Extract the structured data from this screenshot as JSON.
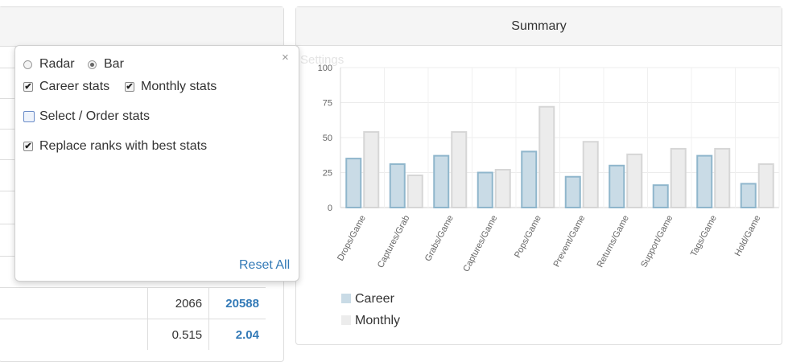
{
  "popover": {
    "chart_type_options": [
      {
        "label": "Radar",
        "selected": false
      },
      {
        "label": "Bar",
        "selected": true
      }
    ],
    "career_stats": {
      "label": "Career stats",
      "checked": true
    },
    "monthly_stats": {
      "label": "Monthly stats",
      "checked": true
    },
    "select_order": {
      "label": "Select / Order stats",
      "checked": false
    },
    "replace_ranks": {
      "label": "Replace ranks with best stats",
      "checked": true
    },
    "close_glyph": "×",
    "reset_label": "Reset All",
    "settings_label": "Settings"
  },
  "table": {
    "rows": [
      {
        "career": "2066",
        "monthly": "20588"
      },
      {
        "career": "0.515",
        "monthly": "2.04"
      }
    ]
  },
  "summary": {
    "title": "Summary"
  },
  "chart_data": {
    "type": "bar",
    "categories": [
      "Drops/Game",
      "Captures/Grab",
      "Grabs/Game",
      "Captures/Game",
      "Pops/Game",
      "Prevent/Game",
      "Returns/Game",
      "Support/Game",
      "Tags/Game",
      "Hold/Game"
    ],
    "series": [
      {
        "name": "Career",
        "values": [
          35,
          31,
          37,
          25,
          40,
          22,
          30,
          16,
          37,
          17
        ],
        "color": "#c9dbe6",
        "stroke": "#8fb6cc"
      },
      {
        "name": "Monthly",
        "values": [
          54,
          23,
          54,
          27,
          72,
          47,
          38,
          42,
          42,
          31
        ],
        "color": "#ececec",
        "stroke": "#d6d6d6"
      }
    ],
    "yticks": [
      0,
      25,
      50,
      75,
      100
    ],
    "ylim": [
      0,
      100
    ],
    "grid": true,
    "legend_placement": "bottom-left"
  }
}
